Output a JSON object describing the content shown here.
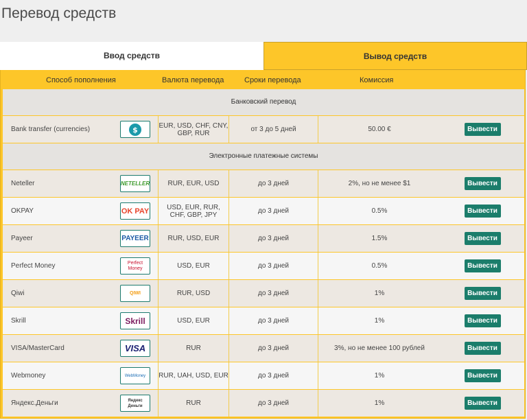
{
  "page": {
    "title": "Перевод средств"
  },
  "tabs": {
    "deposit": "Ввод средств",
    "withdraw": "Вывод средств"
  },
  "table": {
    "headers": {
      "method": "Способ пополнения",
      "currency": "Валюта перевода",
      "term": "Сроки перевода",
      "fee": "Комиссия"
    },
    "sections": {
      "bank": "Банковский перевод",
      "ewallets": "Электронные платежные системы"
    },
    "action_label": "Вывести",
    "bank_rows": [
      {
        "name": "Bank transfer (currencies)",
        "logo": "bank-logo-icon",
        "currency": "EUR, USD, CHF, CNY, GBP, RUR",
        "term": "от 3 до 5 дней",
        "fee": "50.00 €"
      }
    ],
    "rows": [
      {
        "name": "Neteller",
        "logo": "neteller-logo-icon",
        "logo_text": "NETELLER",
        "currency": "RUR, EUR, USD",
        "term": "до 3 дней",
        "fee": "2%, но не менее $1"
      },
      {
        "name": "OKPAY",
        "logo": "okpay-logo-icon",
        "logo_text": "OK PAY",
        "currency": "USD, EUR, RUR, CHF, GBP, JPY",
        "term": "до 3 дней",
        "fee": "0.5%"
      },
      {
        "name": "Payeer",
        "logo": "payeer-logo-icon",
        "logo_text": "PAYEER",
        "currency": "RUR, USD, EUR",
        "term": "до 3 дней",
        "fee": "1.5%"
      },
      {
        "name": "Perfect Money",
        "logo": "perfect-money-logo-icon",
        "logo_text": "Perfect Money",
        "currency": "USD, EUR",
        "term": "до 3 дней",
        "fee": "0.5%"
      },
      {
        "name": "Qiwi",
        "logo": "qiwi-logo-icon",
        "logo_text": "QIWI",
        "currency": "RUR, USD",
        "term": "до 3 дней",
        "fee": "1%"
      },
      {
        "name": "Skrill",
        "logo": "skrill-logo-icon",
        "logo_text": "Skrill",
        "currency": "USD, EUR",
        "term": "до 3 дней",
        "fee": "1%"
      },
      {
        "name": "VISA/MasterCard",
        "logo": "visa-logo-icon",
        "logo_text": "VISA",
        "currency": "RUR",
        "term": "до 3 дней",
        "fee": "3%, но не менее 100 рублей"
      },
      {
        "name": "Webmoney",
        "logo": "webmoney-logo-icon",
        "logo_text": "WebMoney",
        "currency": "RUR, UAH, USD, EUR",
        "term": "до 3 дней",
        "fee": "1%"
      },
      {
        "name": "Яндекс.Деньги",
        "logo": "yandex-money-logo-icon",
        "logo_text": "Яндекс Деньги",
        "currency": "RUR",
        "term": "до 3 дней",
        "fee": "1%"
      }
    ]
  },
  "colors": {
    "accent": "#fdc629",
    "button": "#1b7d6b",
    "row_alt": "#f6f6f6",
    "row_base": "#ede8e2",
    "section": "#e5e3e0"
  }
}
